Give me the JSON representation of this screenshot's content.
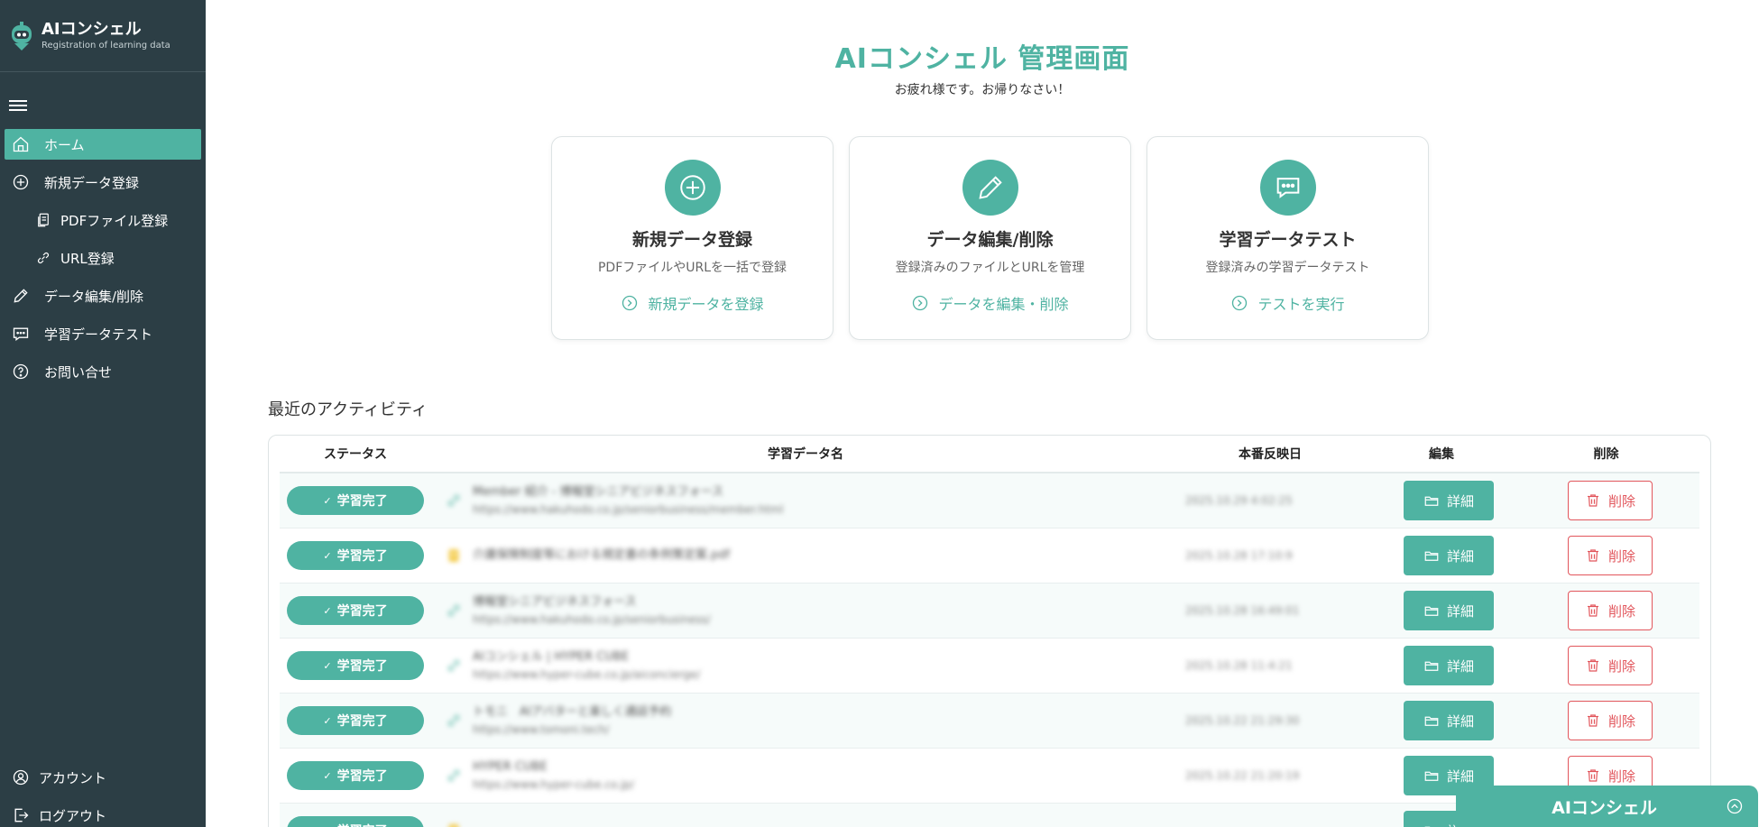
{
  "brand": {
    "title": "AIコンシェル",
    "subtitle": "Registration of learning data"
  },
  "sidebar": {
    "items": [
      {
        "label": "ホーム",
        "icon": "home-icon",
        "active": true
      },
      {
        "label": "新規データ登録",
        "icon": "plus-circle-icon"
      },
      {
        "label": "PDFファイル登録",
        "icon": "file-icon",
        "sub": true
      },
      {
        "label": "URL登録",
        "icon": "link-icon",
        "sub": true
      },
      {
        "label": "データ編集/削除",
        "icon": "pencil-icon"
      },
      {
        "label": "学習データテスト",
        "icon": "chat-icon"
      },
      {
        "label": "お問い合せ",
        "icon": "help-icon"
      }
    ],
    "bottom": [
      {
        "label": "アカウント",
        "icon": "account-icon"
      },
      {
        "label": "ログアウト",
        "icon": "logout-icon"
      }
    ]
  },
  "header": {
    "title": "AIコンシェル 管理画面",
    "subtitle": "お疲れ様です。お帰りなさい！"
  },
  "cards": [
    {
      "title": "新規データ登録",
      "desc": "PDFファイルやURLを一括で登録",
      "link": "新規データを登録",
      "icon": "plus-circle-icon"
    },
    {
      "title": "データ編集/削除",
      "desc": "登録済みのファイルとURLを管理",
      "link": "データを編集・削除",
      "icon": "pencil-icon"
    },
    {
      "title": "学習データテスト",
      "desc": "登録済みの学習データテスト",
      "link": "テストを実行",
      "icon": "chat-icon"
    }
  ],
  "activity": {
    "title": "最近のアクティビティ",
    "columns": [
      "ステータス",
      "学習データ名",
      "本番反映日",
      "編集",
      "削除"
    ],
    "status_label": "学習完了",
    "edit_label": "詳細",
    "delete_label": "削除",
    "rows": [
      {
        "type": "url",
        "name": "Member 紹介 - 博報堂シニアビジネスフォース",
        "url": "https://www.hakuhodo.co.jp/seniorbusiness/member.html",
        "date": "2025.10.29 4:02:25"
      },
      {
        "type": "pdf",
        "name": "介護保険制度等における規定書の条例策定案.pdf",
        "url": "",
        "date": "2025.10.28 17:10:9"
      },
      {
        "type": "url",
        "name": "博報堂シニアビジネスフォース",
        "url": "https://www.hakuhodo.co.jp/seniorbusiness/",
        "date": "2025.10.28 16:49:01"
      },
      {
        "type": "url",
        "name": "AIコンシェル | HYPER CUBE",
        "url": "https://www.hyper-cube.co.jp/aiconcierge/",
        "date": "2025.10.28 11:4:21"
      },
      {
        "type": "url",
        "name": "トモニ　AIアバターと楽しく通話予約",
        "url": "https://www.tomoni.tech/",
        "date": "2025.10.22 21:29:30"
      },
      {
        "type": "url",
        "name": "HYPER CUBE",
        "url": "https://www.hyper-cube.co.jp/",
        "date": "2025.10.22 21:20:19"
      },
      {
        "type": "pdf",
        "name": "",
        "url": "",
        "date": ""
      }
    ]
  },
  "chat": {
    "title": "AIコンシェル"
  },
  "colors": {
    "accent": "#4fb3a2",
    "sidebar": "#2c3e45",
    "danger": "#e2565c"
  }
}
